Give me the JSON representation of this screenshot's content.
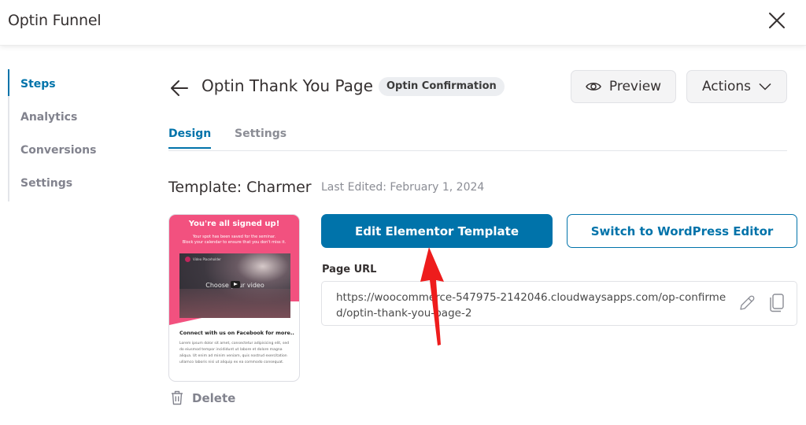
{
  "header": {
    "title": "Optin Funnel",
    "close_icon": "close-icon"
  },
  "sidebar": {
    "items": [
      {
        "label": "Steps",
        "active": true
      },
      {
        "label": "Analytics",
        "active": false
      },
      {
        "label": "Conversions",
        "active": false
      },
      {
        "label": "Settings",
        "active": false
      }
    ]
  },
  "step": {
    "back_icon": "arrow-left-icon",
    "title": "Optin Thank You Page",
    "badge": "Optin Confirmation",
    "preview_label": "Preview",
    "actions_label": "Actions"
  },
  "tabs": [
    {
      "label": "Design",
      "active": true
    },
    {
      "label": "Settings",
      "active": false
    }
  ],
  "template": {
    "title": "Template: Charmer",
    "last_edited": "Last Edited: February 1, 2024",
    "thumbnail": {
      "heading": "You're all signed up!",
      "subtext_line1": "Your spot has been saved for the seminar.",
      "subtext_line2": "Block your calendar to ensure that you don't miss it.",
      "video_label": "Video Placeholder",
      "video_text": "Choose your video",
      "facebook_heading": "Connect with us on Facebook for more..",
      "lorem": "Lorem ipsum dolor sit amet, consectetur adipisicing elit, sed do eiusmod tempor incididunt ut labore et dolore magna aliqua. Ut enim ad minim veniam, quis nostrud exercitation ullamco laboris nisi ut aliquip ex ea commodo consequat."
    },
    "delete_label": "Delete"
  },
  "buttons": {
    "edit_elementor": "Edit Elementor Template",
    "switch_wordpress": "Switch to WordPress Editor"
  },
  "page_url": {
    "label": "Page URL",
    "value": "https://woocommerce-547975-2142046.cloudwaysapps.com/op-confirmed/optin-thank-you-page-2"
  },
  "colors": {
    "accent": "#0073aa",
    "thumbnail_pink": "#f2517f",
    "annotation_arrow": "#ee1c1c"
  }
}
